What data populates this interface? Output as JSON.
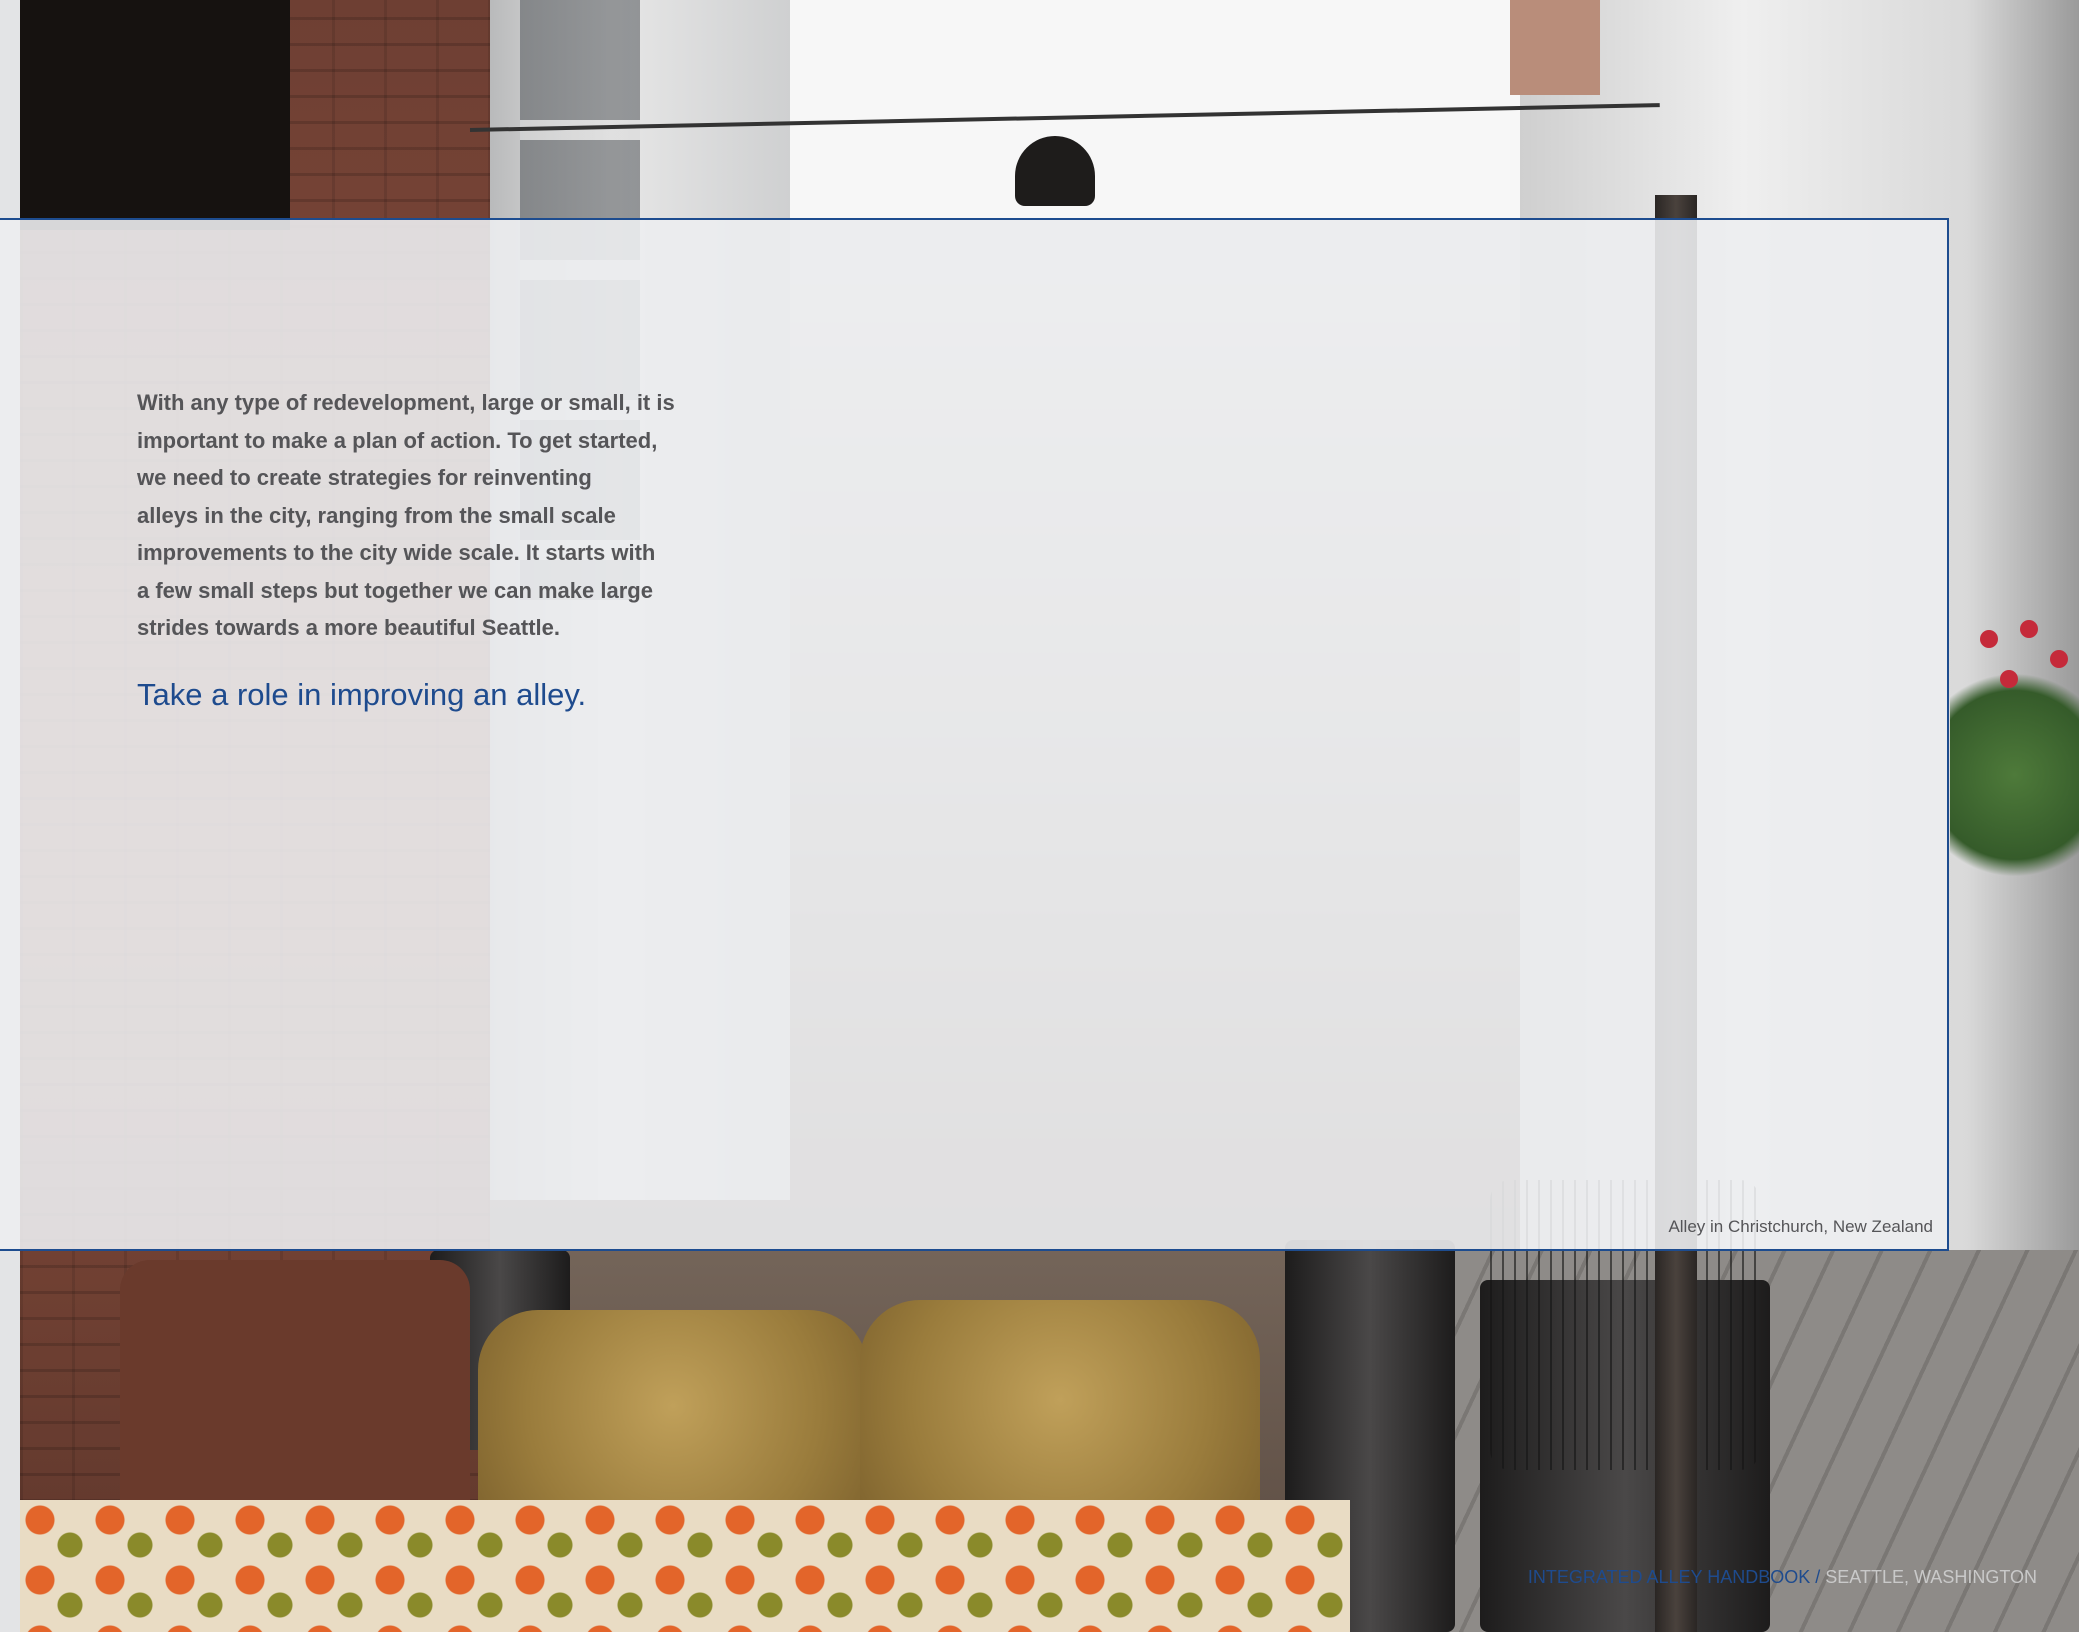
{
  "photo": {
    "subject": "alley-scene"
  },
  "content": {
    "body_text": "With any type of redevelopment, large or small, it is\nimportant to make a plan of action.  To get started,\nwe need to create strategies for reinventing\nalleys in the city, ranging from the small scale\nimprovements to the city wide scale.  It starts with\na few small steps but together we can make large\nstrides towards a more beautiful Seattle.",
    "tagline": "Take a role in improving an alley.",
    "caption": "Alley in Christchurch, New Zealand"
  },
  "footer": {
    "publication": "INTEGRATED ALLEY HANDBOOK",
    "separator": "/",
    "location": "SEATTLE, WASHINGTON"
  },
  "colors": {
    "accent_blue": "#1e4b8e",
    "body_text_gray": "#555558",
    "overlay": "#ecedf0",
    "footer_location_gray": "#c9c9c9"
  }
}
